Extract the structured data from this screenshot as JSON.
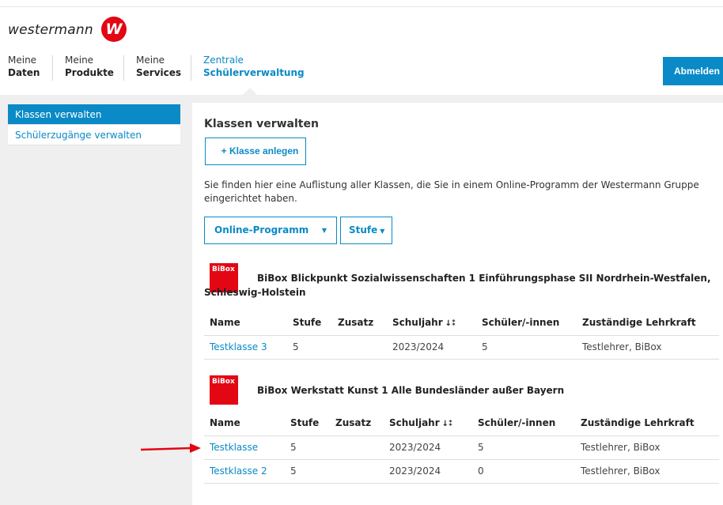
{
  "brand": {
    "name": "westermann",
    "badge_letter": "W",
    "badge_color": "#e30613"
  },
  "accent_color": "#0a8ac6",
  "nav": [
    {
      "line1": "Meine",
      "line2": "Daten",
      "active": false
    },
    {
      "line1": "Meine",
      "line2": "Produkte",
      "active": false
    },
    {
      "line1": "Meine",
      "line2": "Services",
      "active": false
    },
    {
      "line1": "Zentrale",
      "line2": "Schülerverwaltung",
      "active": true
    }
  ],
  "logout_label": "Abmelden",
  "sidebar": {
    "items": [
      {
        "label": "Klassen verwalten",
        "active": true
      },
      {
        "label": "Schülerzugänge verwalten",
        "active": false
      }
    ]
  },
  "main": {
    "title": "Klassen verwalten",
    "add_button": "+ Klasse anlegen",
    "intro": "Sie finden hier eine Auflistung aller Klassen, die Sie in einem Online-Programm der Westermann Gruppe eingerichtet haben.",
    "filters": {
      "program_label": "Online-Programm",
      "program_caret": "▼",
      "stage_label": "Stufe",
      "stage_caret": "▼"
    }
  },
  "table_headers": [
    "Name",
    "Stufe",
    "Zusatz",
    "Schuljahr",
    "Schüler/-innen",
    "Zuständige Lehrkraft"
  ],
  "sort_icon": "↓⁑",
  "programs": [
    {
      "logo": "BiBox",
      "title": "BiBox Blickpunkt Sozialwissenschaften 1 Einführungsphase SII Nordrhein-Westfalen, Schleswig-Holstein",
      "rows": [
        {
          "name": "Testklasse 3",
          "stufe": "5",
          "zusatz": "",
          "schuljahr": "2023/2024",
          "schueler": "5",
          "lehrkraft": "Testlehrer, BiBox"
        }
      ]
    },
    {
      "logo": "BiBox",
      "title": "BiBox Werkstatt Kunst 1 Alle Bundesländer außer Bayern",
      "rows": [
        {
          "name": "Testklasse",
          "stufe": "5",
          "zusatz": "",
          "schuljahr": "2023/2024",
          "schueler": "5",
          "lehrkraft": "Testlehrer, BiBox"
        },
        {
          "name": "Testklasse 2",
          "stufe": "5",
          "zusatz": "",
          "schuljahr": "2023/2024",
          "schueler": "0",
          "lehrkraft": "Testlehrer, BiBox"
        }
      ]
    }
  ],
  "annotation_arrow_color": "#e30613"
}
